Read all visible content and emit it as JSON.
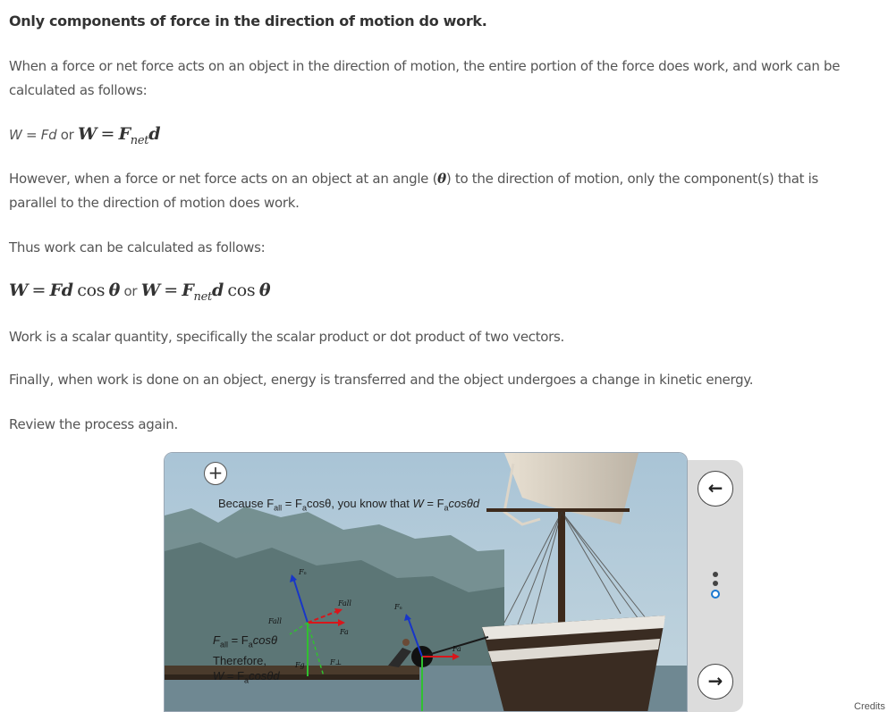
{
  "heading": "Only components of force in the direction of motion do work.",
  "p1": "When a force or net force acts on an object in the direction of motion, the entire portion of the force does work, and work can be calculated as follows:",
  "eq1": {
    "lhs": "W = Fd",
    "or": "or",
    "rhs_w": "W",
    "rhs_eq": "=",
    "rhs_f": "F",
    "rhs_sub": "net",
    "rhs_d": "d"
  },
  "p2": {
    "before": "However, when a force or net force acts on an object at an angle (",
    "theta": "θ",
    "after": ") to the direction of motion, only the component(s) that is parallel to the direction of motion does work."
  },
  "p3": "Thus work can be calculated as follows:",
  "eq2": {
    "a": "W",
    "eq": "=",
    "b": "Fd",
    "cos": "cos",
    "th": "θ",
    "or": "or",
    "c": "W",
    "eq2": "=",
    "d": "F",
    "sub": "net",
    "e": "d",
    "cos2": "cos",
    "th2": "θ"
  },
  "p4": "Work is a scalar quantity, specifically the scalar product or dot product of two vectors.",
  "p5": "Finally, when work is done on an object, energy is transferred and the object undergoes a change in kinetic energy.",
  "p6": "Review the process again.",
  "panel": {
    "zoom_label": "+",
    "caption": {
      "a": "Because F",
      "s1": "all",
      "b": " = F",
      "s2": "a",
      "c": "cosθ, you know that ",
      "w": "W",
      "d": " = F",
      "s3": "a",
      "e": "cosθd"
    },
    "note": {
      "l1a": "F",
      "l1s": "all",
      "l1b": " = F",
      "l1s2": "a",
      "l1c": "cosθ",
      "l2": "Therefore,",
      "l3a": "W",
      "l3b": " = F",
      "l3s": "a",
      "l3c": "cosθd"
    },
    "force_labels": {
      "fn1": "Fₙ",
      "fall1": "Fall",
      "fn2": "Fₙ",
      "fall2": "Fall",
      "fa1": "Fa",
      "fa2": "Fa",
      "fg": "Fg",
      "fperp": "F⊥"
    }
  },
  "side": {
    "back": "←",
    "next": "→"
  },
  "credits": "Credits",
  "colors": {
    "accent_blue": "#1b78d0",
    "arrow_red": "#d8161b",
    "arrow_green": "#30c030",
    "arrow_blue": "#1836c8"
  }
}
